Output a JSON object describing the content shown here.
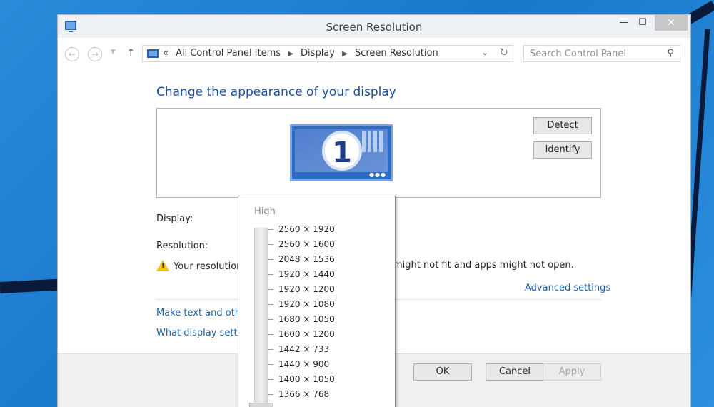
{
  "window": {
    "title": "Screen Resolution",
    "controls": {
      "minimize": "—",
      "maximize": "☐",
      "close": "✕"
    }
  },
  "address_bar": {
    "breadcrumbs": [
      "All Control Panel Items",
      "Display",
      "Screen Resolution"
    ],
    "overflow_glyph": "«",
    "search_placeholder": "Search Control Panel"
  },
  "main": {
    "heading": "Change the appearance of your display",
    "monitor_number": "1",
    "detect_label": "Detect",
    "identify_label": "Identify",
    "display_label": "Display:",
    "resolution_label": "Resolution:",
    "warning_start": "Your resolution",
    "warning_end": "might not fit and apps might not open.",
    "advanced_link": "Advanced settings",
    "link_text_size": "Make text and other",
    "link_display_settings": "What display setting"
  },
  "footer": {
    "ok_label": "OK",
    "cancel_label": "Cancel",
    "apply_label": "Apply"
  },
  "resolution_popup": {
    "high_label": "High",
    "options": [
      "2560 × 1920",
      "2560 × 1600",
      "2048 × 1536",
      "1920 × 1440",
      "1920 × 1200",
      "1920 × 1080",
      "1680 × 1050",
      "1600 × 1200",
      "1442 × 733",
      "1440 × 900",
      "1400 × 1050",
      "1366 × 768"
    ]
  },
  "colors": {
    "accent": "#1e4f9c",
    "link": "#1e5fa8",
    "desktop": "#2a8ad8"
  }
}
